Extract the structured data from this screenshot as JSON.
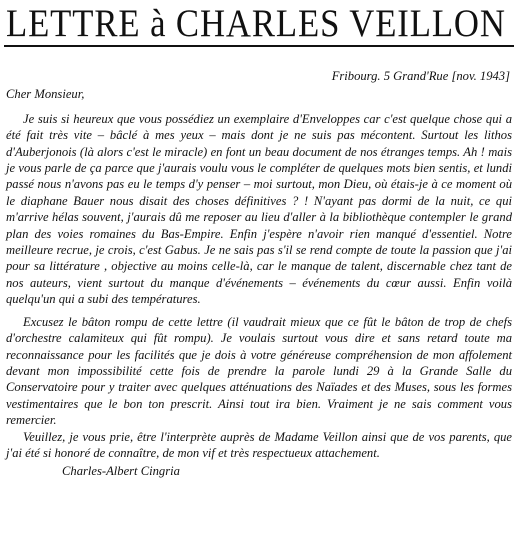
{
  "title": "LETTRE à CHARLES VEILLON",
  "letter": {
    "dateline": "Fribourg. 5 Grand'Rue [nov. 1943]",
    "salutation": "Cher Monsieur,",
    "paragraphs": [
      "Je suis si heureux que vous possédiez un exemplaire d'Enveloppes car c'est quelque chose qui a été fait très vite – bâclé à mes yeux – mais dont je ne suis pas mécontent. Surtout les lithos d'Auberjonois (là alors c'est le miracle) en font un beau document de nos étranges temps. Ah ! mais je vous parle de ça parce que j'aurais voulu vous le compléter de quelques mots bien sentis, et lundi passé nous n'avons pas eu le temps d'y penser – moi surtout, mon Dieu, où étais-je à ce moment où le diaphane Bauer nous disait des choses définitives ? ! N'ayant pas dormi de la nuit, ce qui m'arrive hélas souvent, j'aurais dû me reposer au lieu d'aller à la biblio­thèque contempler le grand plan des voies romaines du Bas-Empire. Enfin j'espère n'avoir rien manqué d'essentiel. Notre meilleure recrue, je crois, c'est Gabus. Je ne sais pas s'il se rend compte de toute la passion que j'ai pour sa littérature , objective au moins celle-là, car le manque de talent, discernable chez tant de nos auteurs, vient surtout du manque d'événements – événements du cœur aussi. Enfin voilà quelqu'un qui a subi des températures.",
      "Excusez le bâton rompu de cette lettre (il vaudrait mieux que ce fût le bâton de trop de chefs d'orchestre calamiteux qui fût rompu). Je voulais surtout vous dire et sans retard toute ma reconnaissance pour les facilités que je dois à votre généreuse compréhension de mon affolement devant mon impossibilité cette fois de prendre la parole lundi 29 à la Grande Salle du Conservatoire pour y traiter avec quelques atténuations des Naïades et des Muses, sous les formes vestimentaires que le bon ton prescrit. Ainsi tout ira bien. Vraiment je ne sais comment vous remercier.",
      "Veuillez, je vous prie, être l'interprète auprès de Madame Veillon ainsi que de vos parents, que j'ai été si honoré de connaître, de mon vif et très respectueux attache­ment."
    ],
    "signature": "Charles-Albert Cingria"
  }
}
